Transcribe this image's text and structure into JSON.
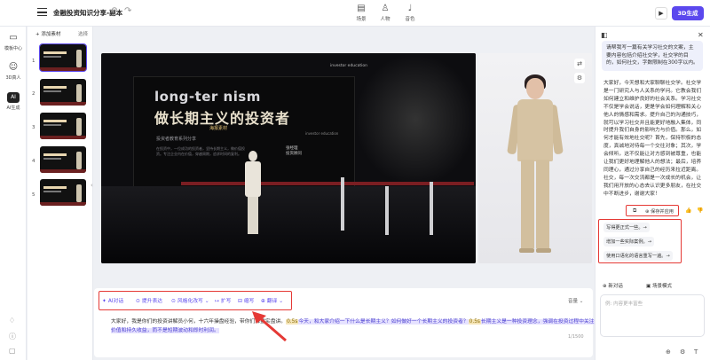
{
  "header": {
    "doc_title": "金融投资知识分享-副本",
    "nav": [
      {
        "label": "场景",
        "icon": "▤"
      },
      {
        "label": "人物",
        "icon": "♙"
      },
      {
        "label": "音色",
        "icon": "♩"
      }
    ],
    "generate_label": "3D生成",
    "play_icon": "▶"
  },
  "rail": {
    "items": [
      {
        "label": "模板中心",
        "icon": "▭"
      },
      {
        "label": "3D真人",
        "icon": "☺"
      },
      {
        "label": "AI生成",
        "icon": "AI"
      }
    ]
  },
  "scenes": {
    "add_label": "+ 添加素材",
    "select_label": "选择",
    "items": [
      "1",
      "2",
      "3",
      "4",
      "5"
    ]
  },
  "canvas": {
    "big_en": "long-ter  nism",
    "big_cn": "做长期主义的投资者",
    "gold_tag": "海报素材",
    "sub_cn": "投资者教育系列分享",
    "para_cn": "在投资中，一位成功的投资者，坚持长期主义，做价值投资。专注企业内在价值，穿越周期，追求时间的复利。",
    "inv_label": "investor education",
    "inv_label2": "investor education",
    "speaker_name": "张经理",
    "speaker_role": "投资顾问"
  },
  "toolbar": {
    "items": [
      {
        "label": "AI对话",
        "icon": "✦"
      },
      {
        "label": "提升表达",
        "icon": "⊙"
      },
      {
        "label": "风格化改写",
        "icon": "⊙"
      },
      {
        "label": "扩写",
        "icon": "↦"
      },
      {
        "label": "缩写",
        "icon": "⊟"
      },
      {
        "label": "翻译",
        "icon": "⊕"
      }
    ],
    "volume_label": "音量",
    "char_count": "1/1500"
  },
  "script": {
    "line1_a": "大家好，我是你们的投资讲解员小何，十六年操盘经验，带你们解盘实盘讲。",
    "pause1": "0.5s",
    "line1_b": "今天，和大家介绍一下什么是长期主义？如何做好一个长期主义的投资者？",
    "pause2": "0.5s",
    "line1_c": "长期主义是一种投资理念，强调在投资过程中关注长期",
    "line2": "价值和持久收益，而不是短期波动和即时利润。"
  },
  "chat": {
    "user_msg": "请帮我写一篇有关学习社交的文案，主要内容包括介绍社交学，社交学的目的，如何社交，字数限制在300字以内。",
    "ai_msg": "大家好，今天想和大家聊聊社交学。社交学是一门研究人与人关系的学问。它教会我们如何建立和维护良好的社会关系。学习社交不仅是学会说话，更是学会如何理解和关心他人的情感和需求。提升自己的沟通技巧，就可以学习社交并且能更好地融入集体，同时提升我们自身的影响力与价值。那么，如何才能有效地社交呢？首先，保持积极的态度，真诚地对待每一个交往对象；其次，学会倾听，这不仅能让对方感到被尊重，也能让我们更好地理解他人的想法；最后，培养同理心，通过分享自己的经历来拉近距离。社交，每一次交流都是一次成长的机会，让我们用开放的心态去认识更多朋友，在社交中不断进步，谢谢大家！",
    "copy_icon": "⧉",
    "save_label": "保存并应用",
    "suggestions": [
      "写得更正式一些。→",
      "增加一些实际案例。→",
      "使用口语化的语言重写一遍。→"
    ],
    "new_chat_label": "新对话",
    "scene_mode_label": "场景模式",
    "input_placeholder": "例: 内容更丰富些"
  }
}
